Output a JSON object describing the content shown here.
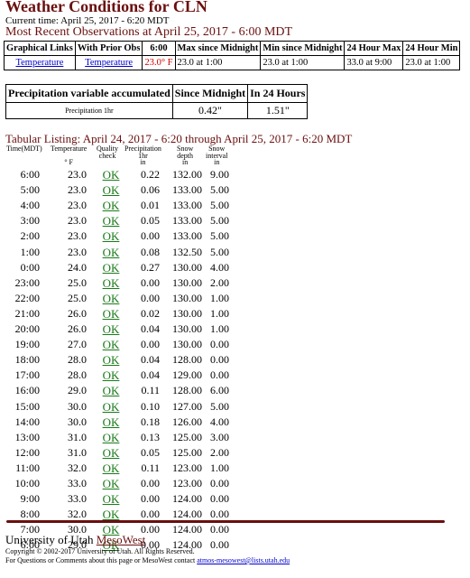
{
  "page": {
    "title": "Weather Conditions for CLN",
    "current_time": "Current time: April 25, 2017 - 6:20 MDT",
    "most_recent": "Most Recent Observations at April 25, 2017 - 6:00 MDT"
  },
  "obs_table": {
    "headers": [
      "Graphical Links",
      "With Prior Obs",
      "6:00",
      "Max since Midnight",
      "Min since Midnight",
      "24 Hour Max",
      "24 Hour Min"
    ],
    "row": {
      "graph_link": "Temperature",
      "prior_link": "Temperature",
      "current": "23.0° F",
      "max_midnight": "23.0 at 1:00",
      "min_midnight": "23.0 at 1:00",
      "max_24": "33.0 at 9:00",
      "min_24": "23.0 at 1:00"
    },
    "current_color": "#d00000"
  },
  "precip_table": {
    "headers": [
      "Precipitation variable accumulated",
      "Since Midnight",
      "In 24 Hours"
    ],
    "row": {
      "variable": "Precipitation 1hr",
      "since_midnight": "0.42\"",
      "in_24": "1.51\""
    }
  },
  "tabular": {
    "heading": "Tabular Listing: April 24, 2017 - 6:20 through April 25, 2017 - 6:20 MDT",
    "col_headers": {
      "time": "Time(MDT)",
      "temp": "Temperature",
      "temp_unit": "° F",
      "quality": "Quality",
      "quality2": "check",
      "precip": "Precipitation",
      "precip2": "1hr",
      "precip3": "in",
      "depth": "Snow",
      "depth2": "depth",
      "depth3": "in",
      "interval": "Snow",
      "interval2": "interval",
      "interval3": "in"
    },
    "rows": [
      {
        "time": "6:00",
        "temp": "23.0",
        "q": "OK",
        "p": "0.22",
        "d": "132.00",
        "i": "9.00"
      },
      {
        "time": "5:00",
        "temp": "23.0",
        "q": "OK",
        "p": "0.06",
        "d": "133.00",
        "i": "5.00"
      },
      {
        "time": "4:00",
        "temp": "23.0",
        "q": "OK",
        "p": "0.01",
        "d": "133.00",
        "i": "5.00"
      },
      {
        "time": "3:00",
        "temp": "23.0",
        "q": "OK",
        "p": "0.05",
        "d": "133.00",
        "i": "5.00"
      },
      {
        "time": "2:00",
        "temp": "23.0",
        "q": "OK",
        "p": "0.00",
        "d": "133.00",
        "i": "5.00"
      },
      {
        "time": "1:00",
        "temp": "23.0",
        "q": "OK",
        "p": "0.08",
        "d": "132.50",
        "i": "5.00"
      },
      {
        "time": "0:00",
        "temp": "24.0",
        "q": "OK",
        "p": "0.27",
        "d": "130.00",
        "i": "4.00"
      },
      {
        "time": "23:00",
        "temp": "25.0",
        "q": "OK",
        "p": "0.00",
        "d": "130.00",
        "i": "2.00"
      },
      {
        "time": "22:00",
        "temp": "25.0",
        "q": "OK",
        "p": "0.00",
        "d": "130.00",
        "i": "1.00"
      },
      {
        "time": "21:00",
        "temp": "26.0",
        "q": "OK",
        "p": "0.02",
        "d": "130.00",
        "i": "1.00"
      },
      {
        "time": "20:00",
        "temp": "26.0",
        "q": "OK",
        "p": "0.04",
        "d": "130.00",
        "i": "1.00"
      },
      {
        "time": "19:00",
        "temp": "27.0",
        "q": "OK",
        "p": "0.00",
        "d": "130.00",
        "i": "0.00"
      },
      {
        "time": "18:00",
        "temp": "28.0",
        "q": "OK",
        "p": "0.04",
        "d": "128.00",
        "i": "0.00"
      },
      {
        "time": "17:00",
        "temp": "28.0",
        "q": "OK",
        "p": "0.04",
        "d": "129.00",
        "i": "0.00"
      },
      {
        "time": "16:00",
        "temp": "29.0",
        "q": "OK",
        "p": "0.11",
        "d": "128.00",
        "i": "6.00"
      },
      {
        "time": "15:00",
        "temp": "30.0",
        "q": "OK",
        "p": "0.10",
        "d": "127.00",
        "i": "5.00"
      },
      {
        "time": "14:00",
        "temp": "30.0",
        "q": "OK",
        "p": "0.18",
        "d": "126.00",
        "i": "4.00"
      },
      {
        "time": "13:00",
        "temp": "31.0",
        "q": "OK",
        "p": "0.13",
        "d": "125.00",
        "i": "3.00"
      },
      {
        "time": "12:00",
        "temp": "31.0",
        "q": "OK",
        "p": "0.05",
        "d": "125.00",
        "i": "2.00"
      },
      {
        "time": "11:00",
        "temp": "32.0",
        "q": "OK",
        "p": "0.11",
        "d": "123.00",
        "i": "1.00"
      },
      {
        "time": "10:00",
        "temp": "33.0",
        "q": "OK",
        "p": "0.00",
        "d": "123.00",
        "i": "0.00"
      },
      {
        "time": "9:00",
        "temp": "33.0",
        "q": "OK",
        "p": "0.00",
        "d": "124.00",
        "i": "0.00"
      },
      {
        "time": "8:00",
        "temp": "32.0",
        "q": "OK",
        "p": "0.00",
        "d": "124.00",
        "i": "0.00"
      },
      {
        "time": "7:00",
        "temp": "30.0",
        "q": "OK",
        "p": "0.00",
        "d": "124.00",
        "i": "0.00"
      },
      {
        "time": "6:00",
        "temp": "29.0",
        "q": "OK",
        "p": "0.00",
        "d": "124.00",
        "i": "0.00"
      }
    ]
  },
  "footer": {
    "org": "University of Utah ",
    "mesowest_link": "MesoWest",
    "copyright": "Copyright © 2002-2017 University of Utah. All Rights Reserved.",
    "contact_prefix": "For Questions or Comments about this page or MesoWest contact ",
    "contact_email": "atmos-mesowest@lists.utah.edu",
    "accent_color": "#6b0f0f"
  }
}
